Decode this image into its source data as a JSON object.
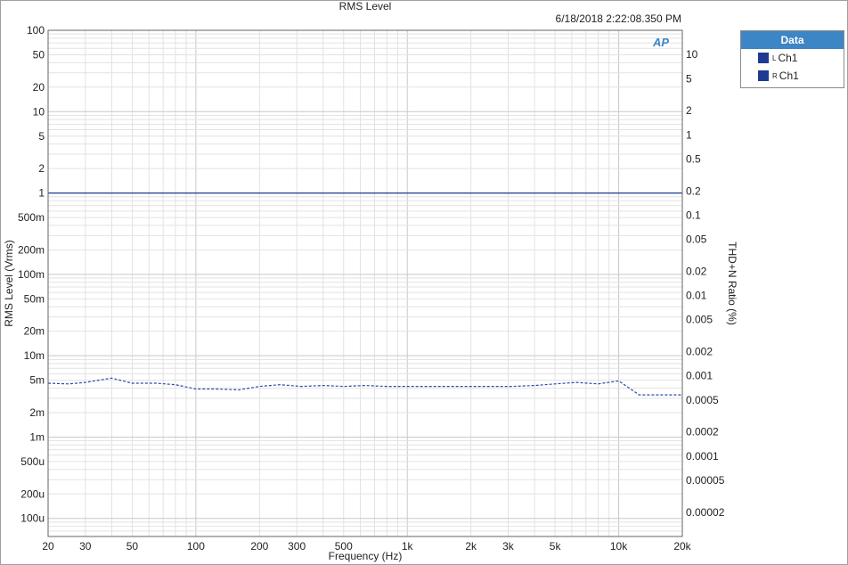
{
  "chart_data": {
    "type": "line",
    "title": "RMS Level",
    "timestamp": "6/18/2018 2:22:08.350 PM",
    "xlabel": "Frequency (Hz)",
    "ylabel_left": "RMS Level (Vrms)",
    "ylabel_right": "THD+N Ratio (%)",
    "x_scale": "log",
    "y_scale": "log",
    "xlim": [
      20,
      20000
    ],
    "ylim_left": [
      6e-05,
      100
    ],
    "ylim_right": [
      1e-05,
      20
    ],
    "grid": true,
    "legend_position": "top-right",
    "x_ticks": [
      {
        "value": 20,
        "label": "20"
      },
      {
        "value": 30,
        "label": "30"
      },
      {
        "value": 50,
        "label": "50"
      },
      {
        "value": 100,
        "label": "100"
      },
      {
        "value": 200,
        "label": "200"
      },
      {
        "value": 300,
        "label": "300"
      },
      {
        "value": 500,
        "label": "500"
      },
      {
        "value": 1000,
        "label": "1k"
      },
      {
        "value": 2000,
        "label": "2k"
      },
      {
        "value": 3000,
        "label": "3k"
      },
      {
        "value": 5000,
        "label": "5k"
      },
      {
        "value": 10000,
        "label": "10k"
      },
      {
        "value": 20000,
        "label": "20k"
      }
    ],
    "y_ticks_left": [
      {
        "value": 100,
        "label": "100"
      },
      {
        "value": 50,
        "label": "50"
      },
      {
        "value": 20,
        "label": "20"
      },
      {
        "value": 10,
        "label": "10"
      },
      {
        "value": 5,
        "label": "5"
      },
      {
        "value": 2,
        "label": "2"
      },
      {
        "value": 1,
        "label": "1"
      },
      {
        "value": 0.5,
        "label": "500m"
      },
      {
        "value": 0.2,
        "label": "200m"
      },
      {
        "value": 0.1,
        "label": "100m"
      },
      {
        "value": 0.05,
        "label": "50m"
      },
      {
        "value": 0.02,
        "label": "20m"
      },
      {
        "value": 0.01,
        "label": "10m"
      },
      {
        "value": 0.005,
        "label": "5m"
      },
      {
        "value": 0.002,
        "label": "2m"
      },
      {
        "value": 0.001,
        "label": "1m"
      },
      {
        "value": 0.0005,
        "label": "500u"
      },
      {
        "value": 0.0002,
        "label": "200u"
      },
      {
        "value": 0.0001,
        "label": "100u"
      }
    ],
    "y_ticks_right": [
      {
        "value": 10,
        "label": "10"
      },
      {
        "value": 5,
        "label": "5"
      },
      {
        "value": 2,
        "label": "2"
      },
      {
        "value": 1,
        "label": "1"
      },
      {
        "value": 0.5,
        "label": "0.5"
      },
      {
        "value": 0.2,
        "label": "0.2"
      },
      {
        "value": 0.1,
        "label": "0.1"
      },
      {
        "value": 0.05,
        "label": "0.05"
      },
      {
        "value": 0.02,
        "label": "0.02"
      },
      {
        "value": 0.01,
        "label": "0.01"
      },
      {
        "value": 0.005,
        "label": "0.005"
      },
      {
        "value": 0.002,
        "label": "0.002"
      },
      {
        "value": 0.001,
        "label": "0.001"
      },
      {
        "value": 0.0005,
        "label": "0.0005"
      },
      {
        "value": 0.0002,
        "label": "0.0002"
      },
      {
        "value": 0.0001,
        "label": "0.0001"
      },
      {
        "value": 5e-05,
        "label": "0.00005"
      },
      {
        "value": 2e-05,
        "label": "0.00002"
      }
    ],
    "series": [
      {
        "legend_label": "Ch1",
        "channel": "L",
        "color": "#1f3a93",
        "style": "solid",
        "axis": "left",
        "x": [
          20,
          20000
        ],
        "y": [
          1.0,
          1.0
        ]
      },
      {
        "legend_label": "Ch1",
        "channel": "R",
        "color": "#2b4aa8",
        "style": "dashed",
        "axis": "left",
        "x": [
          20,
          25,
          30,
          40,
          50,
          65,
          80,
          100,
          125,
          160,
          200,
          250,
          315,
          400,
          500,
          630,
          800,
          1000,
          1250,
          1600,
          2000,
          2500,
          3150,
          4000,
          5000,
          6300,
          8000,
          10000,
          12500,
          16000,
          20000
        ],
        "y": [
          0.0046,
          0.0045,
          0.0047,
          0.0053,
          0.0046,
          0.0046,
          0.0044,
          0.0039,
          0.0039,
          0.0038,
          0.0042,
          0.0044,
          0.0042,
          0.0043,
          0.0042,
          0.0043,
          0.0042,
          0.0042,
          0.0042,
          0.0042,
          0.0042,
          0.0042,
          0.0042,
          0.0043,
          0.0045,
          0.0047,
          0.0045,
          0.0049,
          0.0033,
          0.0033,
          0.0033
        ]
      }
    ]
  },
  "legend": {
    "header": "Data",
    "items": [
      {
        "channel": "L",
        "label": "Ch1"
      },
      {
        "channel": "R",
        "label": "Ch1"
      }
    ]
  },
  "logo_text": "AP"
}
